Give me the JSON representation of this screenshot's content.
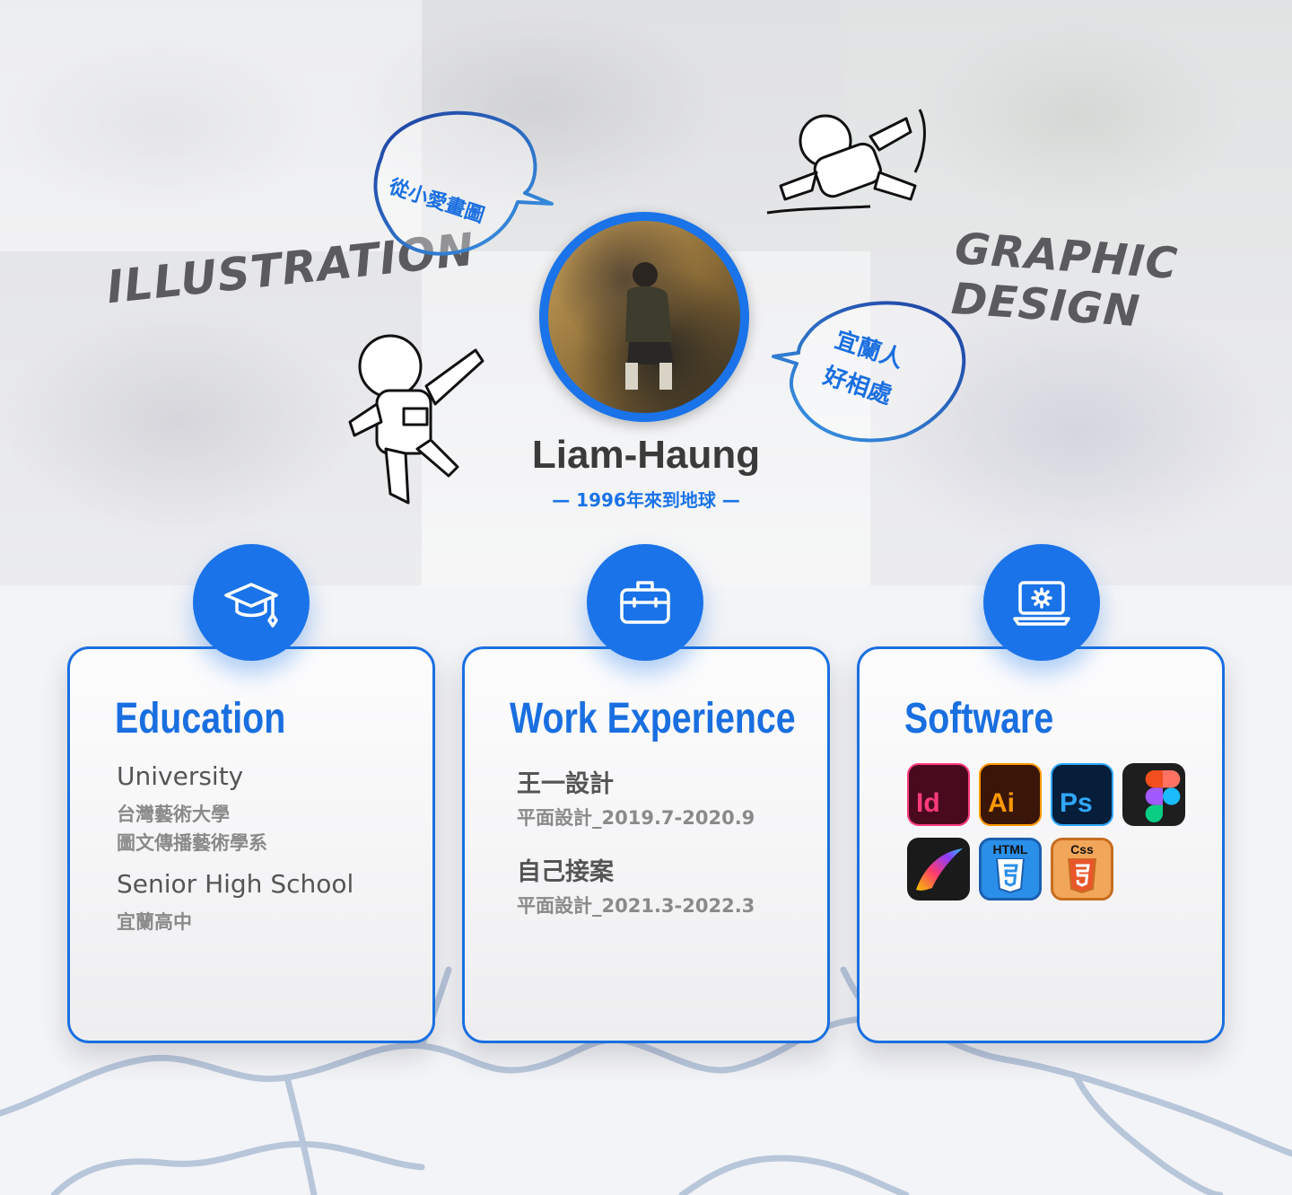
{
  "hero": {
    "script_left": "ILLUSTRATION",
    "script_right": "GRAPHIC DESIGN",
    "bubble_left": "從小愛畫圖",
    "bubble_right_line1": "宜蘭人",
    "bubble_right_line2": "好相處",
    "name": "Liam-Haung",
    "tagline": "— 1996年來到地球 —"
  },
  "education": {
    "title": "Education",
    "icon": "graduation-cap-icon",
    "entries": [
      {
        "level": "University",
        "lines": [
          "台灣藝術大學",
          "圖文傳播藝術學系"
        ]
      },
      {
        "level": "Senior High School",
        "lines": [
          "宜蘭高中"
        ]
      }
    ]
  },
  "work": {
    "title": "Work Experience",
    "icon": "briefcase-icon",
    "entries": [
      {
        "company": "王一設計",
        "detail": "平面設計_2019.7-2020.9"
      },
      {
        "company": "自己接案",
        "detail": "平面設計_2021.3-2022.3"
      }
    ]
  },
  "software": {
    "title": "Software",
    "icon": "laptop-gear-icon",
    "apps": [
      {
        "name": "indesign",
        "label": "Id"
      },
      {
        "name": "illustrator",
        "label": "Ai"
      },
      {
        "name": "photoshop",
        "label": "Ps"
      },
      {
        "name": "figma",
        "label": ""
      },
      {
        "name": "procreate",
        "label": ""
      },
      {
        "name": "html",
        "label": "HTML"
      },
      {
        "name": "css",
        "label": "Css"
      }
    ]
  },
  "colors": {
    "accent": "#1a73e8",
    "title": "#1a6fe0",
    "text": "#555555",
    "muted": "#8a8a8a"
  }
}
